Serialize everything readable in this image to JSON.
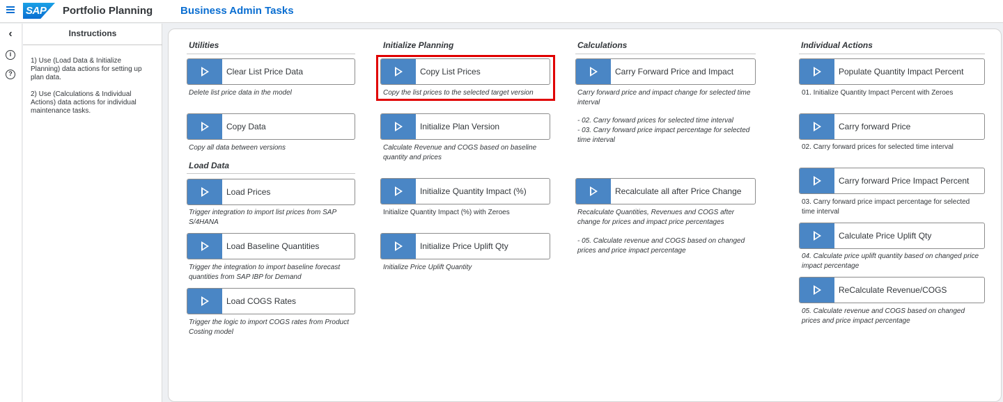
{
  "header": {
    "app_title": "Portfolio Planning",
    "page_title": "Business Admin Tasks",
    "logo_text": "SAP"
  },
  "rail": {
    "back_icon": "chevron-left-icon",
    "info_icon": "info-icon",
    "help_icon": "help-icon",
    "info_glyph": "i",
    "help_glyph": "?"
  },
  "instructions": {
    "title": "Instructions",
    "items": [
      "1) Use (Load Data & Initialize Planning) data actions for setting up plan data.",
      "2) Use (Calculations & Individual Actions) data actions for individual maintenance tasks."
    ]
  },
  "sections": {
    "utilities": "Utilities",
    "load_data": "Load Data",
    "initialize_planning": "Initialize Planning",
    "calculations": "Calculations",
    "individual_actions": "Individual Actions"
  },
  "actions": {
    "clear_list_price": {
      "label": "Clear List Price Data",
      "desc": "Delete list price data in the model"
    },
    "copy_data": {
      "label": "Copy Data",
      "desc": "Copy all data between versions"
    },
    "load_prices": {
      "label": "Load Prices",
      "desc": "Trigger integration to import list prices from SAP S/4HANA"
    },
    "load_baseline": {
      "label": "Load Baseline Quantities",
      "desc": "Trigger the integration to import baseline forecast quantities from SAP IBP for Demand"
    },
    "load_cogs": {
      "label": "Load COGS Rates",
      "desc": "Trigger the logic to import COGS rates from Product Costing model"
    },
    "copy_list_prices": {
      "label": "Copy List Prices",
      "desc": "Copy the list prices to the selected target version"
    },
    "init_plan_version": {
      "label": "Initialize Plan Version",
      "desc": "Calculate Revenue and COGS based on baseline quantity and prices"
    },
    "init_qty_impact": {
      "label": "Initialize Quantity Impact (%)",
      "desc": "Initialize Quantity Impact (%) with Zeroes"
    },
    "init_price_uplift": {
      "label": "Initialize Price Uplift Qty",
      "desc": "Initialize Price Uplift Quantity"
    },
    "carry_forward_price_impact": {
      "label": "Carry Forward Price and Impact",
      "desc": "Carry forward price and impact change for selected time interval",
      "desc2": "- 02. Carry forward prices for selected time interval",
      "desc3": "- 03. Carry forward price impact percentage for selected time interval"
    },
    "recalculate_all": {
      "label": "Recalculate all after Price Change",
      "desc": "Recalculate Quantities, Revenues and COGS after change for prices and impact price percentages",
      "desc2": "- 05. Calculate revenue and COGS based on changed prices and price impact percentage"
    },
    "populate_qty_impact": {
      "label": "Populate Quantity Impact Percent",
      "desc": "01. Initialize Quantity Impact Percent with Zeroes"
    },
    "carry_forward_price": {
      "label": "Carry forward Price",
      "desc": "02. Carry forward prices for selected time interval"
    },
    "carry_forward_impact_pct": {
      "label": "Carry forward Price Impact Percent",
      "desc": "03. Carry forward price impact percentage for selected time interval"
    },
    "calc_price_uplift": {
      "label": "Calculate Price Uplift Qty",
      "desc": "04. Calculate price uplift quantity based on changed price impact percentage"
    },
    "recalc_revenue_cogs": {
      "label": "ReCalculate Revenue/COGS",
      "desc": "05. Calculate revenue and COGS based on changed prices and price impact percentage"
    }
  },
  "colors": {
    "accent": "#0a6ed1",
    "button_play": "#4a86c5",
    "highlight": "#e00000"
  }
}
